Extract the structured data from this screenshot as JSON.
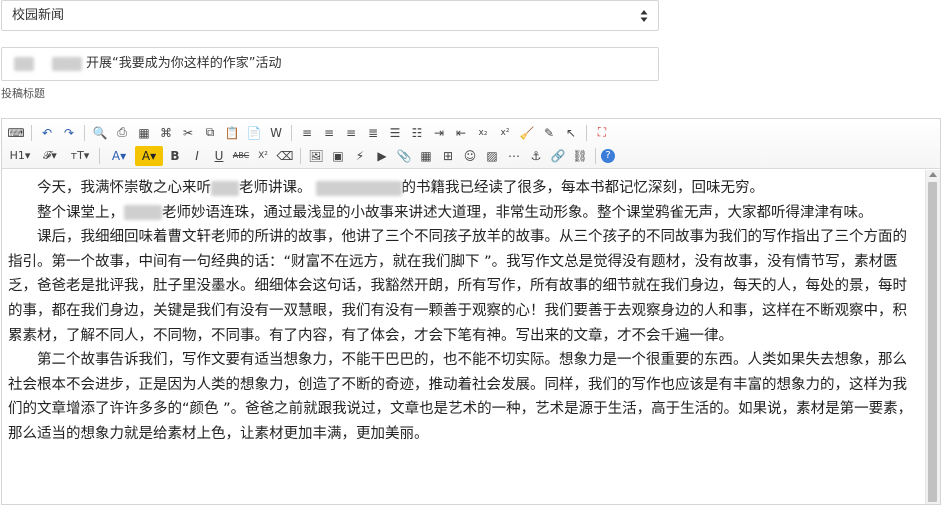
{
  "category_select": {
    "value": "校园新闻"
  },
  "title_field": {
    "value": "开展“我要成为你这样的作家”活动"
  },
  "title_label": "投稿标题",
  "toolbar": {
    "row1": [
      {
        "name": "source-icon",
        "glyph": "⌨"
      },
      {
        "sep": true
      },
      {
        "name": "undo-icon",
        "glyph": "↶"
      },
      {
        "name": "redo-icon",
        "glyph": "↷"
      },
      {
        "sep": true
      },
      {
        "name": "preview-icon",
        "glyph": "🔍"
      },
      {
        "name": "print-icon",
        "glyph": "⎙"
      },
      {
        "name": "template-icon",
        "glyph": "▦"
      },
      {
        "name": "code-icon",
        "glyph": "⌘"
      },
      {
        "name": "cut-icon",
        "glyph": "✂"
      },
      {
        "name": "copy-icon",
        "glyph": "⧉"
      },
      {
        "name": "paste-icon",
        "glyph": "📋"
      },
      {
        "name": "paste-text-icon",
        "glyph": "📄"
      },
      {
        "name": "paste-word-icon",
        "glyph": "W"
      },
      {
        "sep": true
      },
      {
        "name": "align-left-icon",
        "glyph": "≡"
      },
      {
        "name": "align-center-icon",
        "glyph": "≡"
      },
      {
        "name": "align-right-icon",
        "glyph": "≡"
      },
      {
        "name": "align-justify-icon",
        "glyph": "≣"
      },
      {
        "name": "ordered-list-icon",
        "glyph": "☰"
      },
      {
        "name": "unordered-list-icon",
        "glyph": "☷"
      },
      {
        "name": "indent-icon",
        "glyph": "⇥"
      },
      {
        "name": "outdent-icon",
        "glyph": "⇤"
      },
      {
        "name": "subscript-icon",
        "glyph": "x₂"
      },
      {
        "name": "superscript-icon",
        "glyph": "x²"
      },
      {
        "name": "clear-format-icon",
        "glyph": "🧹"
      },
      {
        "name": "select-all-icon",
        "glyph": "✎"
      },
      {
        "name": "cursor-icon",
        "glyph": "↖"
      },
      {
        "sep": true
      },
      {
        "name": "fullscreen-icon",
        "glyph": "⛶"
      }
    ],
    "row2": [
      {
        "name": "heading-icon",
        "glyph": "H1▾",
        "wide": true
      },
      {
        "name": "font-family-icon",
        "glyph": "𝓕▾",
        "wide": true
      },
      {
        "name": "font-size-icon",
        "glyph": "тT▾",
        "wide": true
      },
      {
        "sep": true
      },
      {
        "name": "font-color-icon",
        "glyph": "A▾",
        "wide": true
      },
      {
        "name": "highlight-icon",
        "glyph": "A▾",
        "wide": true
      },
      {
        "name": "bold-icon",
        "glyph": "B"
      },
      {
        "name": "italic-icon",
        "glyph": "I"
      },
      {
        "name": "underline-icon",
        "glyph": "U"
      },
      {
        "name": "strikethrough-icon",
        "glyph": "ABC"
      },
      {
        "name": "superscript-2-icon",
        "glyph": "X²"
      },
      {
        "name": "eraser-icon",
        "glyph": "⌫"
      },
      {
        "sep": true
      },
      {
        "name": "image-icon",
        "glyph": "🖼"
      },
      {
        "name": "multi-image-icon",
        "glyph": "▣"
      },
      {
        "name": "flash-icon",
        "glyph": "⚡"
      },
      {
        "name": "media-icon",
        "glyph": "▶"
      },
      {
        "name": "attachment-icon",
        "glyph": "📎"
      },
      {
        "name": "table-icon",
        "glyph": "▦"
      },
      {
        "name": "insert-row-icon",
        "glyph": "⊞"
      },
      {
        "name": "emoji-icon",
        "glyph": "☺"
      },
      {
        "name": "map-icon",
        "glyph": "▨"
      },
      {
        "name": "pagebreak-icon",
        "glyph": "⋯"
      },
      {
        "name": "anchor-icon",
        "glyph": "⚓"
      },
      {
        "name": "link-icon",
        "glyph": "🔗"
      },
      {
        "name": "unlink-icon",
        "glyph": "⛓"
      },
      {
        "sep": true
      },
      {
        "name": "help-icon",
        "glyph": "?"
      }
    ]
  },
  "content": {
    "paragraphs": [
      {
        "pre": "今天，我满怀崇敬之心来听",
        "post": "老师讲课。",
        "post2": "的书籍我已经读了很多，每本书都记忆深刻，回味无穷。"
      },
      {
        "pre": "整个课堂上，",
        "post": "老师妙语连珠，通过最浅显的小故事来讲述大道理，非常生动形象。整个课堂鸦雀无声，大家都听得津津有味。"
      },
      {
        "text": "课后，我细细回味着曹文轩老师的所讲的故事，他讲了三个不同孩子放羊的故事。从三个孩子的不同故事为我们的写作指出了三个方面的指引。第一个故事，中间有一句经典的话：“财富不在远方，就在我们脚下 ”。我写作文总是觉得没有题材，没有故事，没有情节写，素材匮乏，爸爸老是批评我，肚子里没墨水。细细体会这句话，我豁然开朗，所有写作，所有故事的细节就在我们身边，每天的人，每处的景，每时的事，都在我们身边，关键是我们有没有一双慧眼，我们有没有一颗善于观察的心！我们要善于去观察身边的人和事，这样在不断观察中，积累素材，了解不同人，不同物，不同事。有了内容，有了体会，才会下笔有神。写出来的文章，才不会千遍一律。"
      },
      {
        "text": "第二个故事告诉我们，写作文要有适当想象力，不能干巴巴的，也不能不切实际。想象力是一个很重要的东西。人类如果失去想象，那么社会根本不会进步，正是因为人类的想象力，创造了不断的奇迹，推动着社会发展。同样，我们的写作也应该是有丰富的想象力的，这样为我们的文章增添了许许多多的“颜色 ”。爸爸之前就跟我说过，文章也是艺术的一种，艺术是源于生活，高于生活的。如果说，素材是第一要素，那么适当的想象力就是给素材上色，让素材更加丰满，更加美丽。"
      }
    ]
  }
}
